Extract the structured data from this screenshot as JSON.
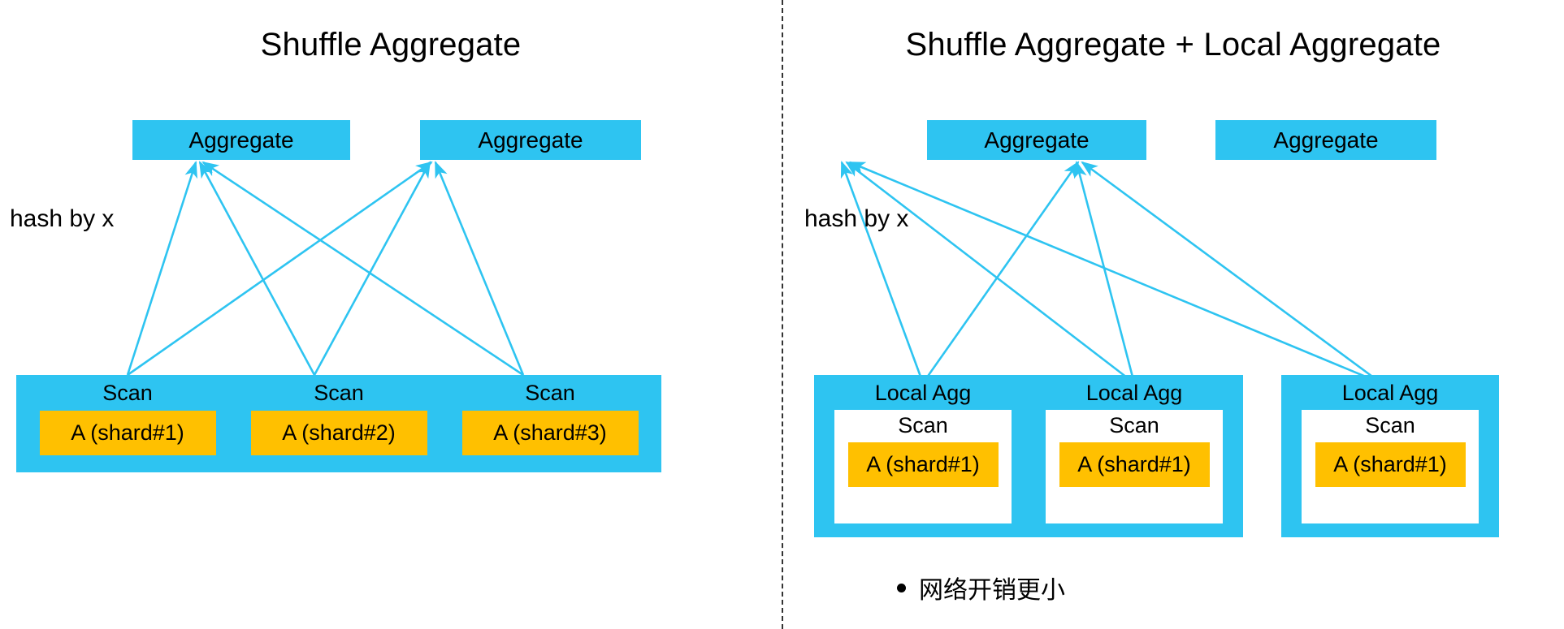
{
  "panels": {
    "left": {
      "title": "Shuffle Aggregate",
      "hash_label": "hash by x",
      "aggregates": [
        {
          "label": "Aggregate"
        },
        {
          "label": "Aggregate"
        }
      ],
      "leaves": [
        {
          "label": "Scan",
          "shard": "A (shard#1)"
        },
        {
          "label": "Scan",
          "shard": "A (shard#2)"
        },
        {
          "label": "Scan",
          "shard": "A (shard#3)"
        }
      ]
    },
    "right": {
      "title": "Shuffle Aggregate + Local Aggregate",
      "hash_label": "hash by x",
      "aggregates": [
        {
          "label": "Aggregate"
        },
        {
          "label": "Aggregate"
        }
      ],
      "leaves": [
        {
          "label": "Local Agg",
          "scan_label": "Scan",
          "shard": "A (shard#1)"
        },
        {
          "label": "Local Agg",
          "scan_label": "Scan",
          "shard": "A (shard#1)"
        },
        {
          "label": "Local Agg",
          "scan_label": "Scan",
          "shard": "A (shard#1)"
        }
      ],
      "bullet": "网络开销更小"
    }
  },
  "colors": {
    "node_fill": "#2ec4f1",
    "shard_fill": "#ffc000",
    "edge_stroke": "#2ec4f1",
    "text": "#000000",
    "divider": "#333333",
    "inner_fill": "#ffffff"
  },
  "chart_data": {
    "type": "diagram",
    "title": "Shuffle Aggregate vs Shuffle Aggregate + Local Aggregate",
    "panels": [
      {
        "name": "Shuffle Aggregate",
        "nodes": [
          {
            "id": "L-agg1",
            "label": "Aggregate",
            "layer": "top"
          },
          {
            "id": "L-agg2",
            "label": "Aggregate",
            "layer": "top"
          },
          {
            "id": "L-scan1",
            "label": "Scan",
            "sublabel": "A (shard#1)",
            "layer": "leaf"
          },
          {
            "id": "L-scan2",
            "label": "Scan",
            "sublabel": "A (shard#2)",
            "layer": "leaf"
          },
          {
            "id": "L-scan3",
            "label": "Scan",
            "sublabel": "A (shard#3)",
            "layer": "leaf"
          }
        ],
        "edges": [
          {
            "from": "L-scan1",
            "to": "L-agg1"
          },
          {
            "from": "L-scan1",
            "to": "L-agg2"
          },
          {
            "from": "L-scan2",
            "to": "L-agg1"
          },
          {
            "from": "L-scan2",
            "to": "L-agg2"
          },
          {
            "from": "L-scan3",
            "to": "L-agg1"
          },
          {
            "from": "L-scan3",
            "to": "L-agg2"
          }
        ],
        "edge_annotation": "hash by x"
      },
      {
        "name": "Shuffle Aggregate + Local Aggregate",
        "nodes": [
          {
            "id": "R-agg1",
            "label": "Aggregate",
            "layer": "top"
          },
          {
            "id": "R-agg2",
            "label": "Aggregate",
            "layer": "top"
          },
          {
            "id": "R-la1",
            "label": "Local Agg",
            "sublabel": "Scan",
            "subsublabel": "A (shard#1)",
            "layer": "leaf"
          },
          {
            "id": "R-la2",
            "label": "Local Agg",
            "sublabel": "Scan",
            "subsublabel": "A (shard#1)",
            "layer": "leaf"
          },
          {
            "id": "R-la3",
            "label": "Local Agg",
            "sublabel": "Scan",
            "subsublabel": "A (shard#1)",
            "layer": "leaf"
          }
        ],
        "edges": [
          {
            "from": "R-la1",
            "to": "R-agg1"
          },
          {
            "from": "R-la1",
            "to": "R-agg2"
          },
          {
            "from": "R-la2",
            "to": "R-agg1"
          },
          {
            "from": "R-la2",
            "to": "R-agg2"
          },
          {
            "from": "R-la3",
            "to": "R-agg1"
          },
          {
            "from": "R-la3",
            "to": "R-agg2"
          }
        ],
        "edge_annotation": "hash by x",
        "notes": [
          "网络开销更小"
        ]
      }
    ]
  }
}
